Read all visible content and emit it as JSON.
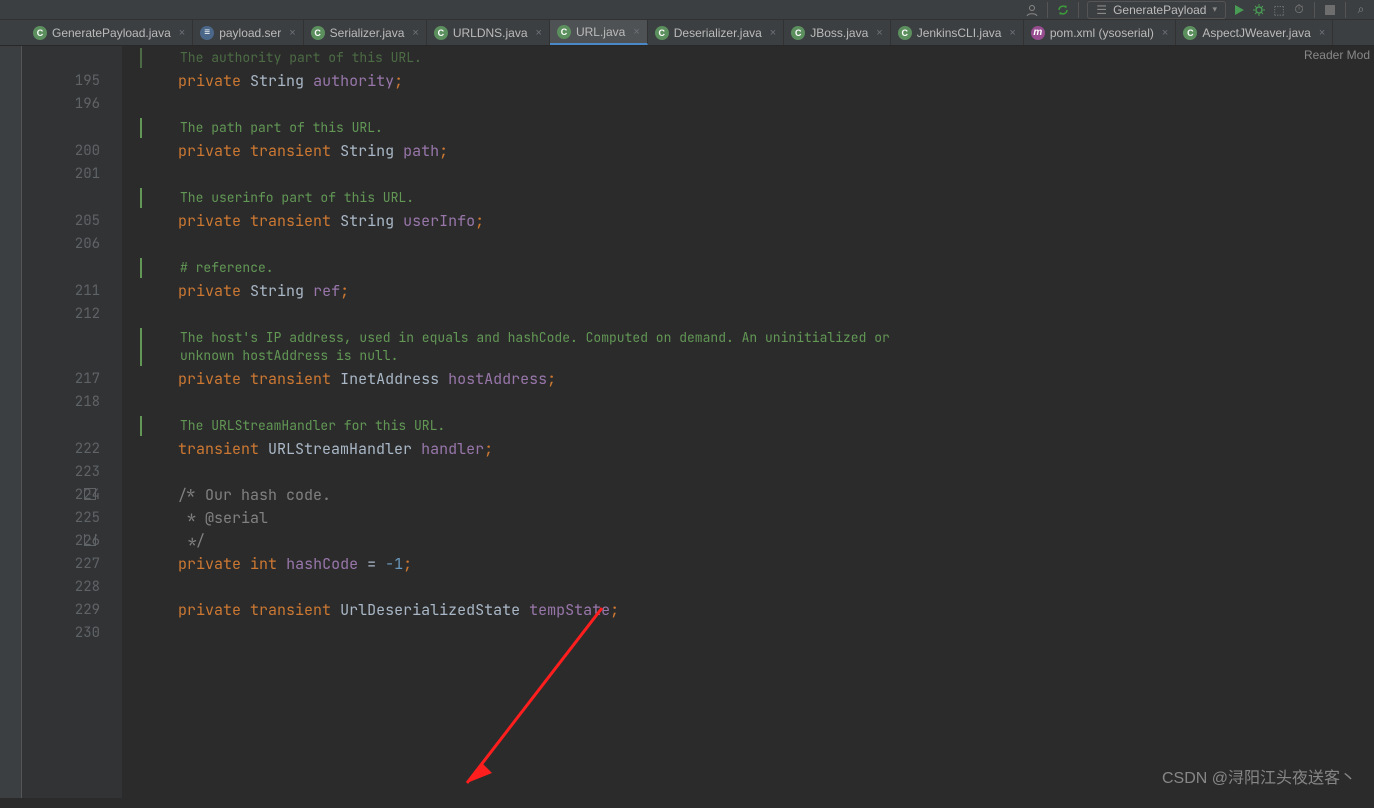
{
  "toolbar": {
    "run_config": "GeneratePayload"
  },
  "tabs": [
    {
      "label": "GeneratePayload.java",
      "icon": "java",
      "active": false
    },
    {
      "label": "payload.ser",
      "icon": "text",
      "active": false
    },
    {
      "label": "Serializer.java",
      "icon": "java",
      "active": false
    },
    {
      "label": "URLDNS.java",
      "icon": "java",
      "active": false
    },
    {
      "label": "URL.java",
      "icon": "java",
      "active": true
    },
    {
      "label": "Deserializer.java",
      "icon": "java",
      "active": false
    },
    {
      "label": "JBoss.java",
      "icon": "java",
      "active": false
    },
    {
      "label": "JenkinsCLI.java",
      "icon": "java",
      "active": false
    },
    {
      "label": "pom.xml (ysoserial)",
      "icon": "maven",
      "active": false
    },
    {
      "label": "AspectJWeaver.java",
      "icon": "java",
      "active": false
    }
  ],
  "reader_mode": "Reader Mod",
  "watermark": "CSDN @浔阳江头夜送客丶",
  "gutter": [
    "",
    "195",
    "196",
    "",
    "200",
    "201",
    "",
    "205",
    "206",
    "",
    "211",
    "212",
    "",
    "",
    "217",
    "218",
    "",
    "222",
    "223",
    "224",
    "225",
    "226",
    "227",
    "228",
    "229",
    "230"
  ],
  "doc": {
    "d0": "The authority part of this URL.",
    "d1": "The path part of this URL.",
    "d2": "The userinfo part of this URL.",
    "d3": "# reference.",
    "d4a": "The host's IP address, used in equals and hashCode. Computed on demand. An uninitialized or",
    "d4b": "unknown hostAddress is null.",
    "d5": "The URLStreamHandler for this URL."
  },
  "code": {
    "kw_private": "private",
    "kw_transient": "transient",
    "kw_int": "int",
    "type_string": "String",
    "type_inet": "InetAddress",
    "type_handler": "URLStreamHandler",
    "type_state": "UrlDeserializedState",
    "f_authority": "authority",
    "f_path": "path",
    "f_userinfo": "userInfo",
    "f_ref": "ref",
    "f_hostaddr": "hostAddress",
    "f_handler": "handler",
    "f_hashcode": "hashCode",
    "f_tempstate": "tempState",
    "neg1": "-1",
    "c1": "/* Our hash code.",
    "c2": " * @serial",
    "c3": " */"
  }
}
